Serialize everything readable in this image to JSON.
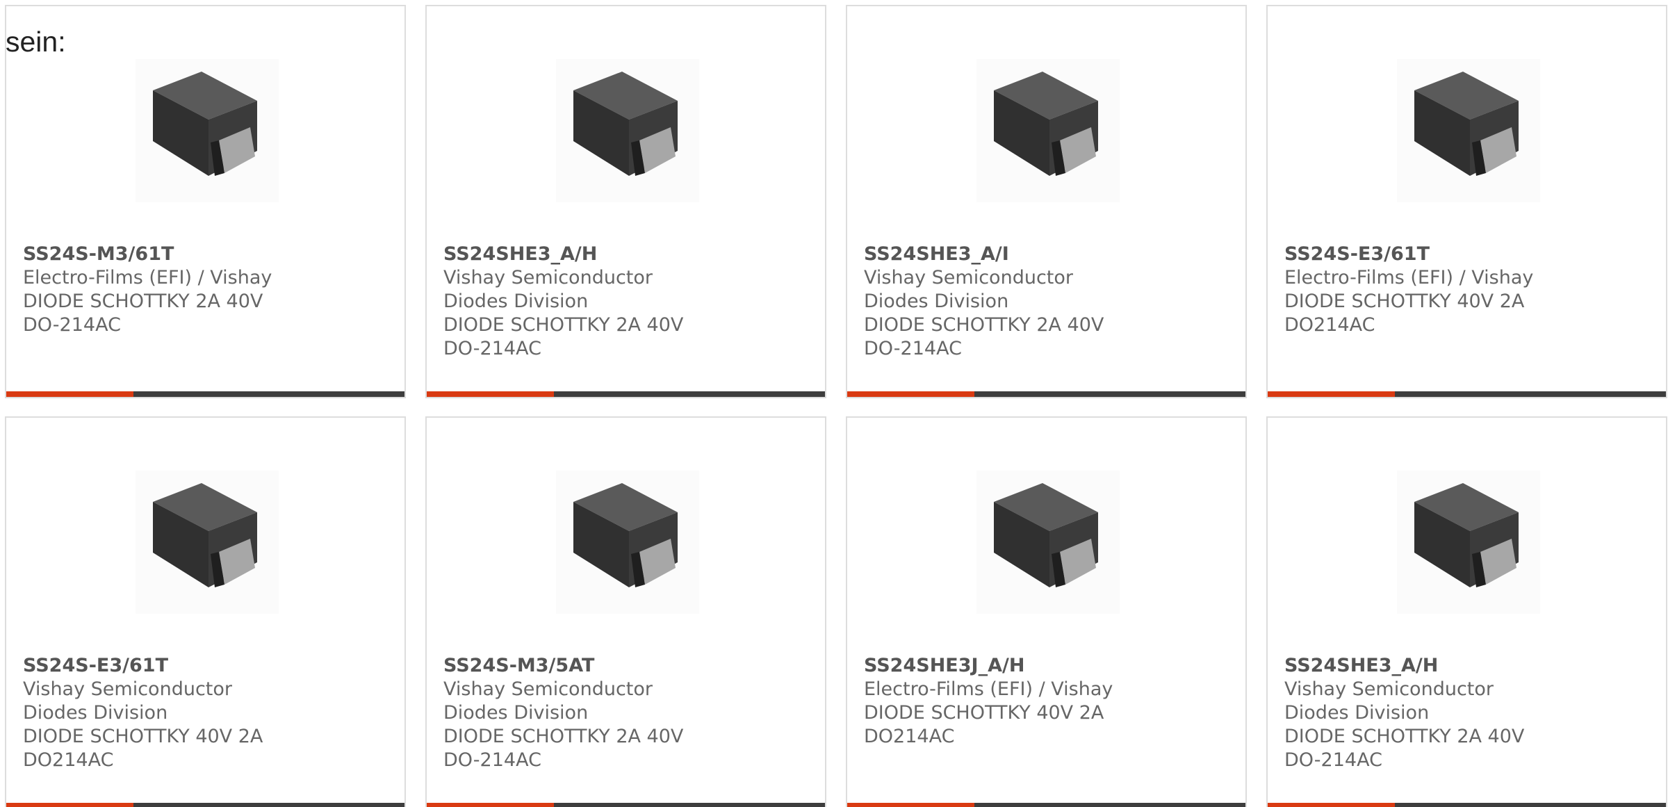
{
  "intro": {
    "text": "sein:"
  },
  "colors": {
    "accent": "#d93a12",
    "bar": "#3d3d3d",
    "border": "#dddddd",
    "text": "#666666"
  },
  "products": [
    {
      "part_number": "SS24S-M3/61T",
      "manufacturer": "Electro-Films (EFI) / Vishay",
      "description": "DIODE SCHOTTKY 2A 40V DO-214AC"
    },
    {
      "part_number": "SS24SHE3_A/H",
      "manufacturer": "Vishay Semiconductor Diodes Division",
      "description": "DIODE SCHOTTKY 2A 40V DO-214AC"
    },
    {
      "part_number": "SS24SHE3_A/I",
      "manufacturer": "Vishay Semiconductor Diodes Division",
      "description": "DIODE SCHOTTKY 2A 40V DO-214AC"
    },
    {
      "part_number": "SS24S-E3/61T",
      "manufacturer": "Electro-Films (EFI) / Vishay",
      "description": "DIODE SCHOTTKY 40V 2A DO214AC"
    },
    {
      "part_number": "SS24S-E3/61T",
      "manufacturer": "Vishay Semiconductor Diodes Division",
      "description": "DIODE SCHOTTKY 40V 2A DO214AC"
    },
    {
      "part_number": "SS24S-M3/5AT",
      "manufacturer": "Vishay Semiconductor Diodes Division",
      "description": "DIODE SCHOTTKY 2A 40V DO-214AC"
    },
    {
      "part_number": "SS24SHE3J_A/H",
      "manufacturer": "Electro-Films (EFI) / Vishay",
      "description": "DIODE SCHOTTKY 40V 2A DO214AC"
    },
    {
      "part_number": "SS24SHE3_A/H",
      "manufacturer": "Vishay Semiconductor Diodes Division",
      "description": "DIODE SCHOTTKY 2A 40V DO-214AC"
    }
  ]
}
